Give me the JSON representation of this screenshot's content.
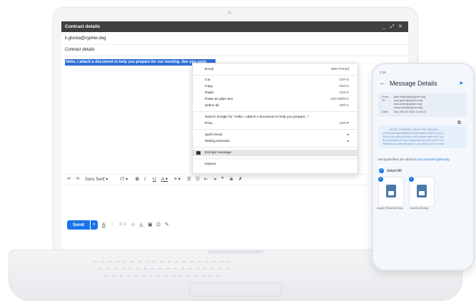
{
  "window": {
    "title": "Contract details",
    "min_label": "_",
    "max_label": "⤢",
    "close_label": "✕"
  },
  "email": {
    "to": "k.glocka@cypher.dog",
    "subject": "Contract details",
    "body_selected": "Hello, I attach a document to help you prepare for our meeting. See you soon"
  },
  "context_menu": {
    "items": [
      {
        "label": "Emoji",
        "shortcut": "Win+Period"
      },
      {
        "label": "Cut",
        "shortcut": "Ctrl+X"
      },
      {
        "label": "Copy",
        "shortcut": "Ctrl+C"
      },
      {
        "label": "Paste",
        "shortcut": "Ctrl+V"
      },
      {
        "label": "Paste as plain text",
        "shortcut": "Ctrl+Shift+V"
      },
      {
        "label": "Select all",
        "shortcut": "Ctrl+A"
      },
      {
        "label": "Search Google for \"Hello, I attach a document to help you prepare...\"",
        "shortcut": ""
      },
      {
        "label": "Print...",
        "shortcut": "Ctrl+P"
      },
      {
        "label": "Spell check",
        "shortcut": "▸"
      },
      {
        "label": "Writing Direction",
        "shortcut": "▸"
      },
      {
        "label": "Encrypt message",
        "shortcut": ""
      },
      {
        "label": "Inspect",
        "shortcut": ""
      }
    ]
  },
  "toolbar": {
    "undo": "↶",
    "redo": "↷",
    "font": "Sans Serif ▾",
    "size": "тT ▾",
    "bold": "B",
    "italic": "I",
    "underline": "U",
    "color": "A ▾",
    "align": "≡ ▾",
    "numbered": "☰",
    "bulleted": "☷",
    "indent_less": "⇤",
    "indent_more": "⇥",
    "quote": "❞",
    "strike": "S",
    "clear": "✗"
  },
  "compose": {
    "send_label": "Send",
    "send_more": "▾",
    "tools": [
      "A",
      "⫶",
      "⊂⊃",
      "☺",
      "◬",
      "▣",
      "⊡",
      "✎"
    ]
  },
  "phone": {
    "time": "2:16",
    "title": "Message Details",
    "back": "←",
    "send_icon": "➤",
    "from_label": "From:",
    "from_value": "piter.williams@cypher.dog",
    "to_label": "To:",
    "to_values": [
      "amy.green@cypher.dog",
      "bob.smith@cypher.dog",
      "emily.clark@cypher.dog"
    ],
    "date_label": "Date:",
    "date_value": "Sun, 30 Oct 2022 14:14:22",
    "pgp_lines": [
      "-----BEGIN CYPHERDOG ENCRYPTED MESSAGE-----",
      "wcFMA5G8fmNaUd8BEAC5R4ZkH2mWQ3nPqE9sTvb7Lx",
      "9hXyRz2pLq8NtAwV6mKcYd3FgJ0bUe7sWhXnR4TqLp",
      "KeZ1mVb8QoPxT6cNs2JdW4aYgF9uHr3EkLzMvC7iOn",
      "P0sR8tQy5wXbN2vMjH6gDfL1kAeZ9cUo4rYiS7nTqW"
    ],
    "stored_text": "Encrypted files are stored in ",
    "stored_link": "Documents/cypherdog",
    "select_all": "Select All",
    "files": [
      {
        "name": "August_Report.pdf.cdog"
      },
      {
        "name": "invoices.pdf.cdog"
      }
    ]
  }
}
